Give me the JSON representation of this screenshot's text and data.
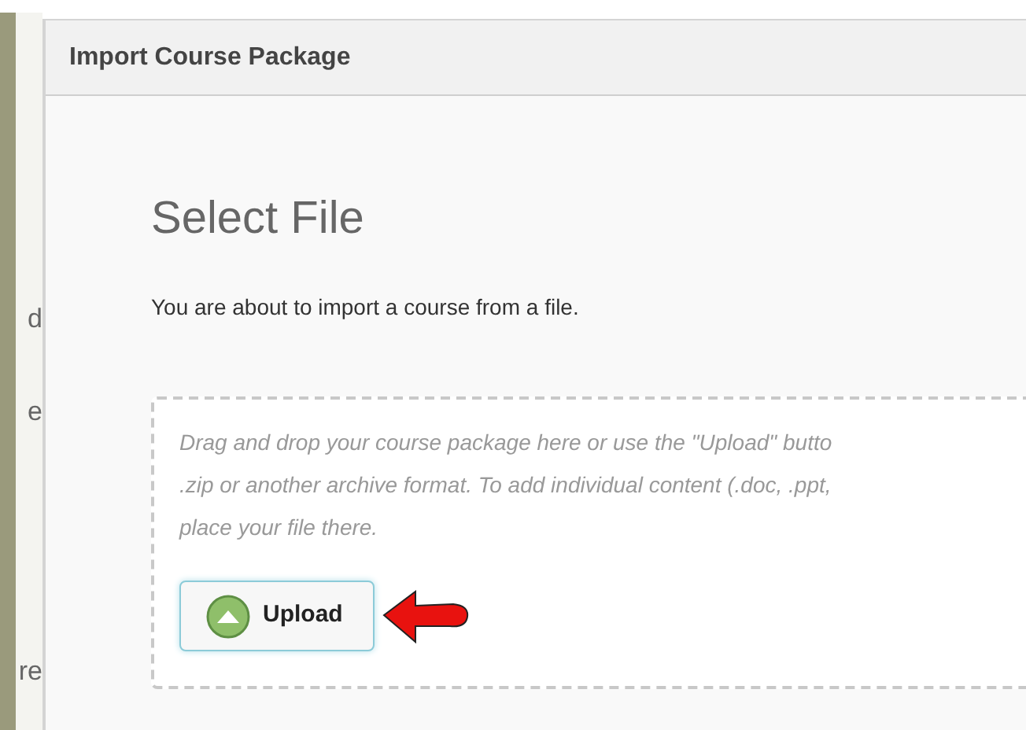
{
  "background_fragments": [
    {
      "text": "d"
    },
    {
      "text": "e"
    },
    {
      "text": "re"
    }
  ],
  "dialog": {
    "title": "Import Course Package",
    "heading": "Select File",
    "intro": "You are about to import a course from a file.",
    "drop_zone": {
      "lines": [
        "Drag and drop your course package here or use the \"Upload\" butto",
        ".zip or another archive format. To add individual content (.doc, .ppt,",
        "place your file there."
      ],
      "upload_button": {
        "label": "Upload"
      }
    }
  }
}
